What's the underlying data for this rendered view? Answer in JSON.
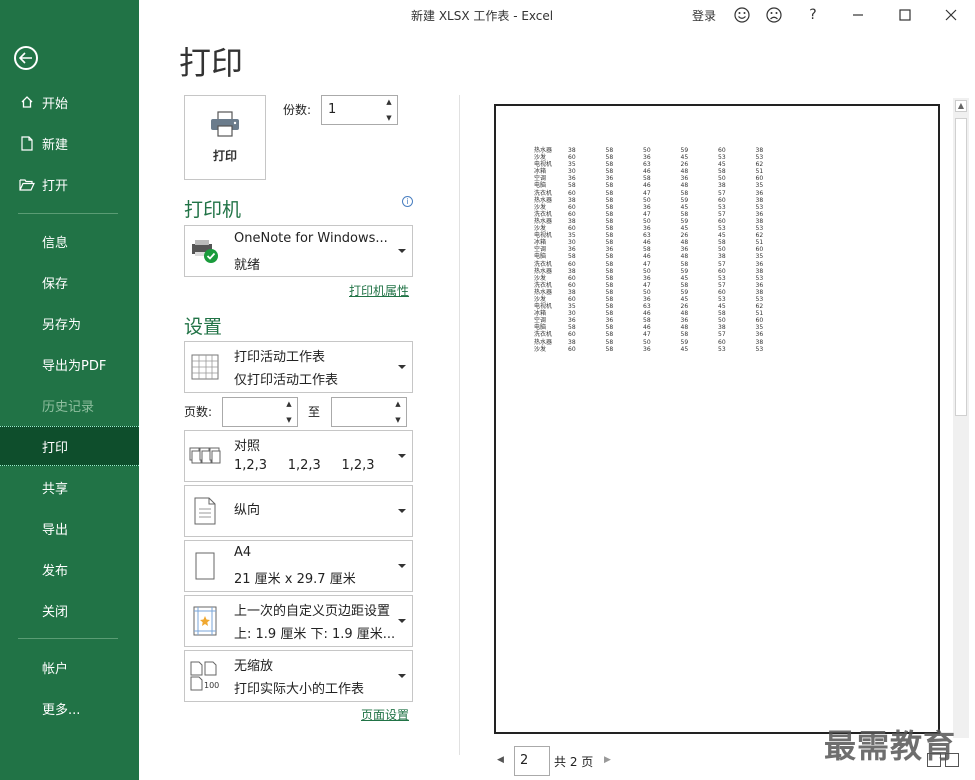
{
  "window": {
    "title": "新建 XLSX 工作表  -  Excel",
    "login": "登录",
    "help": "?"
  },
  "sidebar": {
    "items": [
      {
        "label": "开始"
      },
      {
        "label": "新建"
      },
      {
        "label": "打开"
      },
      {
        "label": "信息"
      },
      {
        "label": "保存"
      },
      {
        "label": "另存为"
      },
      {
        "label": "导出为PDF"
      },
      {
        "label": "历史记录"
      },
      {
        "label": "打印"
      },
      {
        "label": "共享"
      },
      {
        "label": "导出"
      },
      {
        "label": "发布"
      },
      {
        "label": "关闭"
      },
      {
        "label": "帐户"
      },
      {
        "label": "更多..."
      }
    ]
  },
  "print": {
    "title": "打印",
    "button_label": "打印",
    "copies_label": "份数:",
    "copies_value": "1",
    "printer_heading": "打印机",
    "printer_name": "OneNote for Windows...",
    "printer_status": "就绪",
    "printer_props_link": "打印机属性",
    "settings_heading": "设置",
    "scope_l1": "打印活动工作表",
    "scope_l2": "仅打印活动工作表",
    "pages_label": "页数:",
    "to_label": "至",
    "collate_l1": "对照",
    "collate_l2": "1,2,3     1,2,3     1,2,3",
    "orientation": "纵向",
    "paper_l1": "A4",
    "paper_l2": "21 厘米 x 29.7 厘米",
    "margins_l1": "上一次的自定义页边距设置",
    "margins_l2": "上: 1.9 厘米 下: 1.9 厘米...",
    "scaling_l1": "无缩放",
    "scaling_l2": "打印实际大小的工作表",
    "page_setup_link": "页面设置"
  },
  "preview": {
    "current_page": "2",
    "total_pages": "共 2 页",
    "rows": [
      [
        "热水器",
        "38",
        "58",
        "50",
        "59",
        "60",
        "38"
      ],
      [
        "沙发",
        "60",
        "58",
        "36",
        "45",
        "53",
        "53"
      ],
      [
        "电视机",
        "35",
        "58",
        "63",
        "26",
        "45",
        "62"
      ],
      [
        "冰箱",
        "30",
        "58",
        "46",
        "48",
        "58",
        "51"
      ],
      [
        "空调",
        "36",
        "36",
        "58",
        "36",
        "50",
        "60"
      ],
      [
        "电脑",
        "58",
        "58",
        "46",
        "48",
        "38",
        "35"
      ],
      [
        "洗衣机",
        "60",
        "58",
        "47",
        "58",
        "57",
        "36"
      ],
      [
        "热水器",
        "38",
        "58",
        "50",
        "59",
        "60",
        "38"
      ],
      [
        "沙发",
        "60",
        "58",
        "36",
        "45",
        "53",
        "53"
      ],
      [
        "洗衣机",
        "60",
        "58",
        "47",
        "58",
        "57",
        "36"
      ],
      [
        "热水器",
        "38",
        "58",
        "50",
        "59",
        "60",
        "38"
      ],
      [
        "沙发",
        "60",
        "58",
        "36",
        "45",
        "53",
        "53"
      ],
      [
        "电视机",
        "35",
        "58",
        "63",
        "26",
        "45",
        "62"
      ],
      [
        "冰箱",
        "30",
        "58",
        "46",
        "48",
        "58",
        "51"
      ],
      [
        "空调",
        "36",
        "36",
        "58",
        "36",
        "50",
        "60"
      ],
      [
        "电脑",
        "58",
        "58",
        "46",
        "48",
        "38",
        "35"
      ],
      [
        "洗衣机",
        "60",
        "58",
        "47",
        "58",
        "57",
        "36"
      ],
      [
        "热水器",
        "38",
        "58",
        "50",
        "59",
        "60",
        "38"
      ],
      [
        "沙发",
        "60",
        "58",
        "36",
        "45",
        "53",
        "53"
      ],
      [
        "洗衣机",
        "60",
        "58",
        "47",
        "58",
        "57",
        "36"
      ],
      [
        "热水器",
        "38",
        "58",
        "50",
        "59",
        "60",
        "38"
      ],
      [
        "沙发",
        "60",
        "58",
        "36",
        "45",
        "53",
        "53"
      ],
      [
        "电视机",
        "35",
        "58",
        "63",
        "26",
        "45",
        "62"
      ],
      [
        "冰箱",
        "30",
        "58",
        "46",
        "48",
        "58",
        "51"
      ],
      [
        "空调",
        "36",
        "36",
        "58",
        "36",
        "50",
        "60"
      ],
      [
        "电脑",
        "58",
        "58",
        "46",
        "48",
        "38",
        "35"
      ],
      [
        "洗衣机",
        "60",
        "58",
        "47",
        "58",
        "57",
        "36"
      ],
      [
        "热水器",
        "38",
        "58",
        "50",
        "59",
        "60",
        "38"
      ],
      [
        "沙发",
        "60",
        "58",
        "36",
        "45",
        "53",
        "53"
      ]
    ]
  },
  "watermark": "最需教育",
  "colors": {
    "accent": "#217346",
    "active_nav": "#0e4e2c"
  }
}
